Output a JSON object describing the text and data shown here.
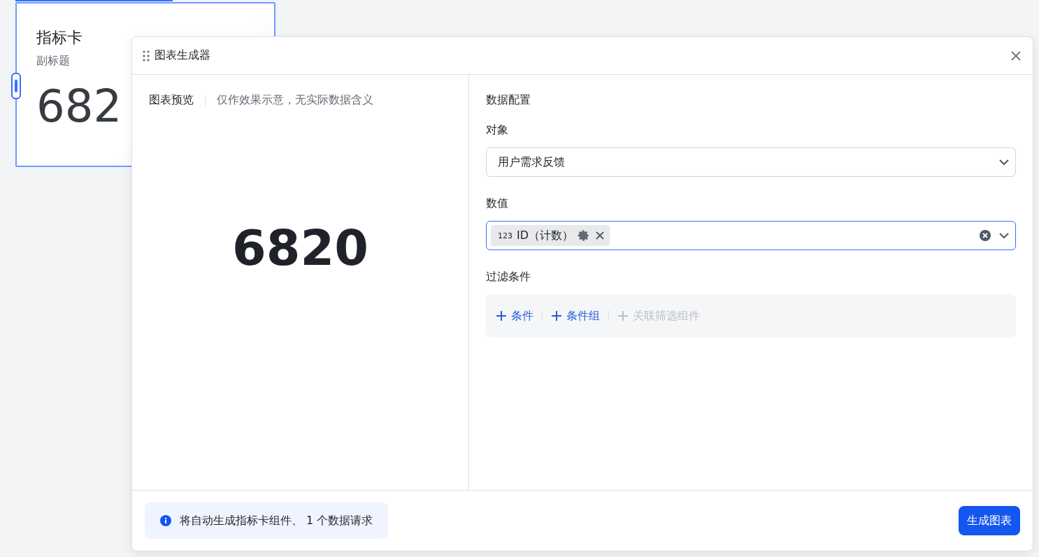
{
  "card": {
    "title": "指标卡",
    "subtitle": "副标题",
    "value": "682",
    "selected": true
  },
  "dialog": {
    "title": "图表生成器",
    "preview": {
      "label": "图表预览",
      "hint": "仅作效果示意，无实际数据含义",
      "value": "6820"
    },
    "config": {
      "heading": "数据配置",
      "object": {
        "label": "对象",
        "value": "用户需求反馈"
      },
      "measure": {
        "label": "数值",
        "focused": true,
        "tags": [
          {
            "type_badge": "123",
            "text": "ID（计数）"
          }
        ]
      },
      "filter": {
        "label": "过滤条件",
        "actions": [
          {
            "label": "条件",
            "disabled": false
          },
          {
            "label": "条件组",
            "disabled": false
          },
          {
            "label": "关联筛选组件",
            "disabled": true
          }
        ]
      }
    },
    "footer": {
      "info": "将自动生成指标卡组件、 1 个数据请求",
      "button": "生成图表"
    }
  }
}
